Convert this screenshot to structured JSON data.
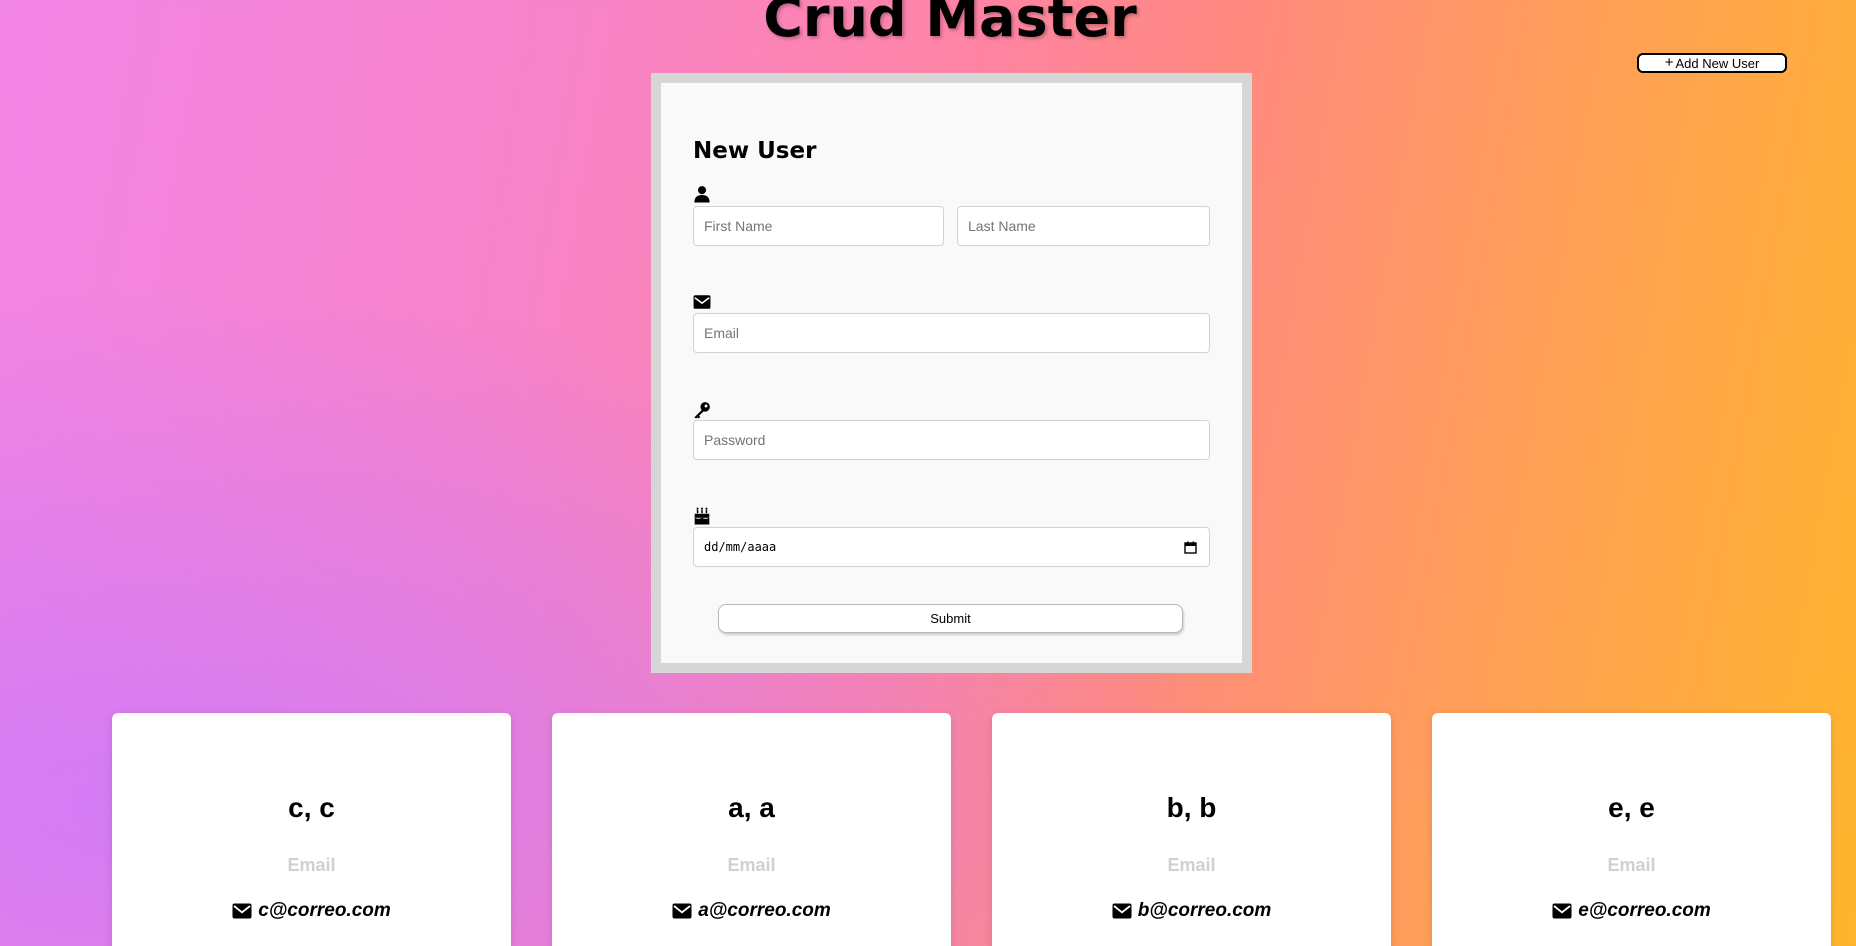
{
  "header": {
    "title": "Crud Master"
  },
  "toolbar": {
    "add_user_label": "Add New User"
  },
  "form": {
    "heading": "New User",
    "first_name": {
      "placeholder": "First Name",
      "value": ""
    },
    "last_name": {
      "placeholder": "Last Name",
      "value": ""
    },
    "email": {
      "placeholder": "Email",
      "value": ""
    },
    "password": {
      "placeholder": "Password",
      "value": ""
    },
    "birthdate": {
      "display": "dd/mm/aaaa"
    },
    "submit_label": "Submit"
  },
  "users": [
    {
      "name": "c, c",
      "email_label": "Email",
      "email": "c@correo.com"
    },
    {
      "name": "a, a",
      "email_label": "Email",
      "email": "a@correo.com"
    },
    {
      "name": "b, b",
      "email_label": "Email",
      "email": "b@correo.com"
    },
    {
      "name": "e, e",
      "email_label": "Email",
      "email": "e@correo.com"
    }
  ],
  "icons": {
    "name_field": "user-icon",
    "email_field": "envelope-icon",
    "password_field": "key-icon",
    "birthdate_field": "birthday-cake-icon",
    "date_picker": "calendar-icon",
    "card_email": "envelope-icon",
    "add_button": "plus-icon"
  },
  "colors": {
    "gradient_start": "#f284e6",
    "gradient_mid": "#ff84a6",
    "gradient_end": "#ffb52c",
    "form_background": "#f9f9f9",
    "form_border": "#d6d6d6",
    "card_background": "#ffffff",
    "muted_label": "#d0d0d0"
  }
}
